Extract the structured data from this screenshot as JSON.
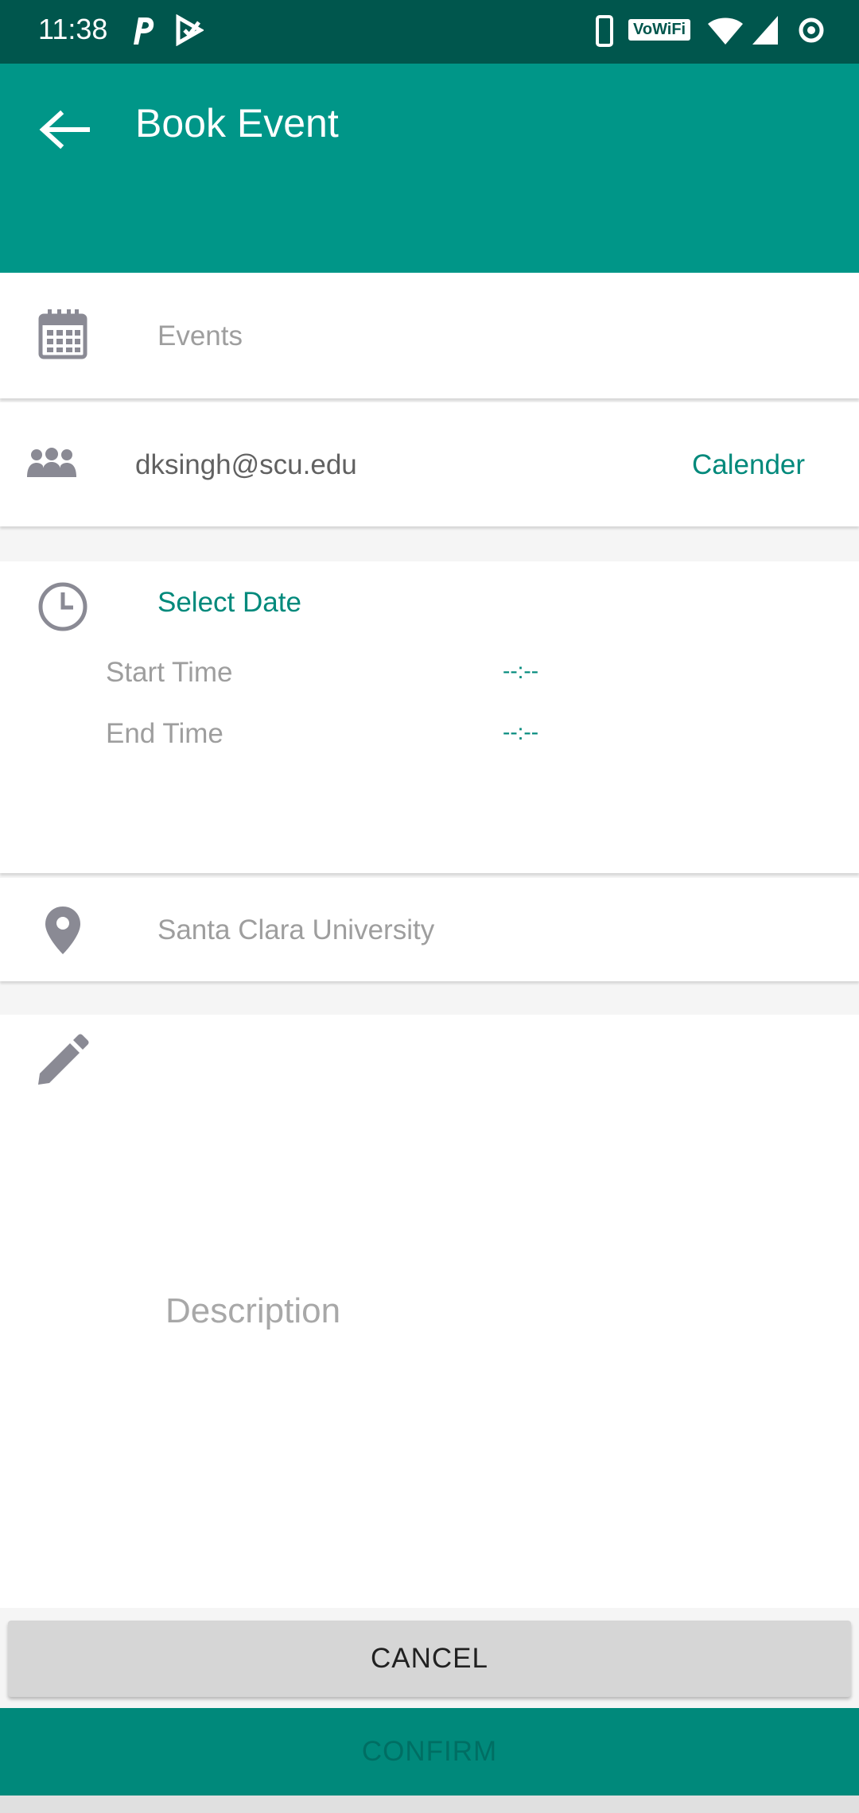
{
  "status_bar": {
    "time": "11:38",
    "icons": [
      "parking-app-icon",
      "play-protect-icon",
      "phone-icon",
      "vowifi-badge",
      "wifi-icon",
      "signal-icon",
      "sync-circle-icon"
    ],
    "vowifi_label": "VoWiFi"
  },
  "app_bar": {
    "back_icon": "arrow-back-icon",
    "title": "Book Event",
    "background_color": "#009688"
  },
  "event_row": {
    "icon": "calendar-icon",
    "placeholder": "Events"
  },
  "attendee_row": {
    "icon": "group-icon",
    "email": "dksingh@scu.edu",
    "action_label": "Calender"
  },
  "time_card": {
    "icon": "clock-icon",
    "select_date_label": "Select Date",
    "start_label": "Start Time",
    "start_value": "--:--",
    "end_label": "End Time",
    "end_value": "--:--"
  },
  "location_row": {
    "icon": "location-pin-icon",
    "value": "Santa Clara University"
  },
  "description": {
    "icon": "pencil-icon",
    "placeholder": "Description"
  },
  "buttons": {
    "cancel_label": "CANCEL",
    "confirm_label": "CONFIRM"
  },
  "colors": {
    "accent": "#009688",
    "status_bar": "#00564d",
    "icon_gray": "#8a8a94"
  }
}
